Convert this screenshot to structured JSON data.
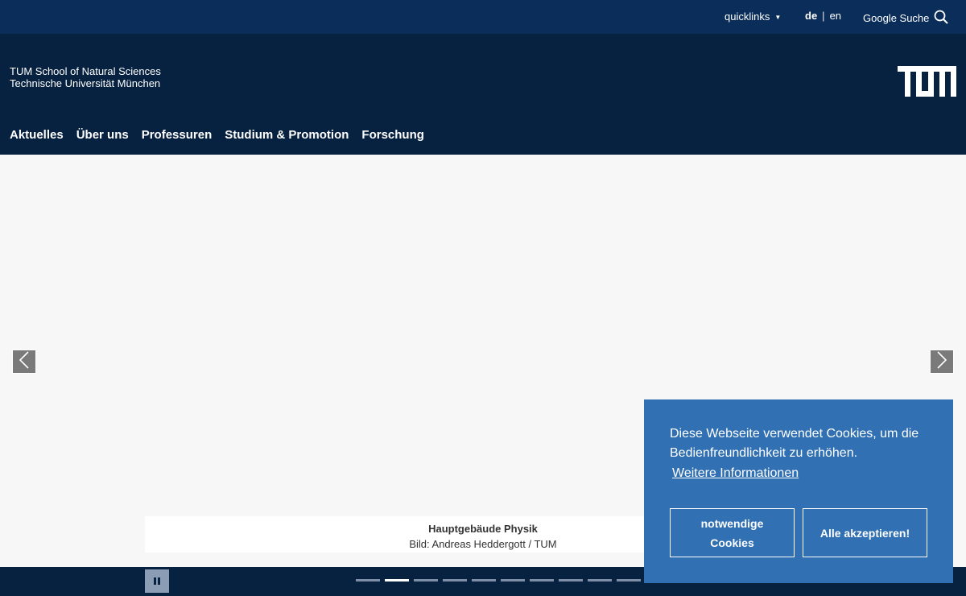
{
  "topbar": {
    "quicklinks_label": "quicklinks",
    "languages": [
      {
        "code": "de",
        "active": true
      },
      {
        "code": "en",
        "active": false
      }
    ],
    "lang_separator": "|",
    "search_label": "Google Suche",
    "background": "#0a2d5a"
  },
  "header": {
    "school_line1": "TUM School of Natural Sciences",
    "school_line2": "Technische Universität München",
    "logo_icon": "tum-logo-icon",
    "background": "#072140",
    "nav": [
      {
        "label": "Aktuelles"
      },
      {
        "label": "Über uns"
      },
      {
        "label": "Professuren"
      },
      {
        "label": "Studium & Promotion"
      },
      {
        "label": "Forschung"
      }
    ]
  },
  "slider": {
    "caption_title": "Hauptgebäude Physik",
    "caption_credit": "Bild: Andreas Heddergott / TUM",
    "prev_icon": "chevron-left-icon",
    "next_icon": "chevron-right-icon",
    "pause_icon": "pause-icon",
    "slide_count": 10,
    "active_slide": 2
  },
  "cookie_banner": {
    "message": "Diese Webseite verwendet Cookies, um die Bedienfreundlichkeit zu erhöhen.",
    "more_link": "Weitere Informationen",
    "necessary_button_line1": "notwendige",
    "necessary_button_line2": "Cookies",
    "accept_button": "Alle akzeptieren!",
    "background": "#3070b3"
  }
}
